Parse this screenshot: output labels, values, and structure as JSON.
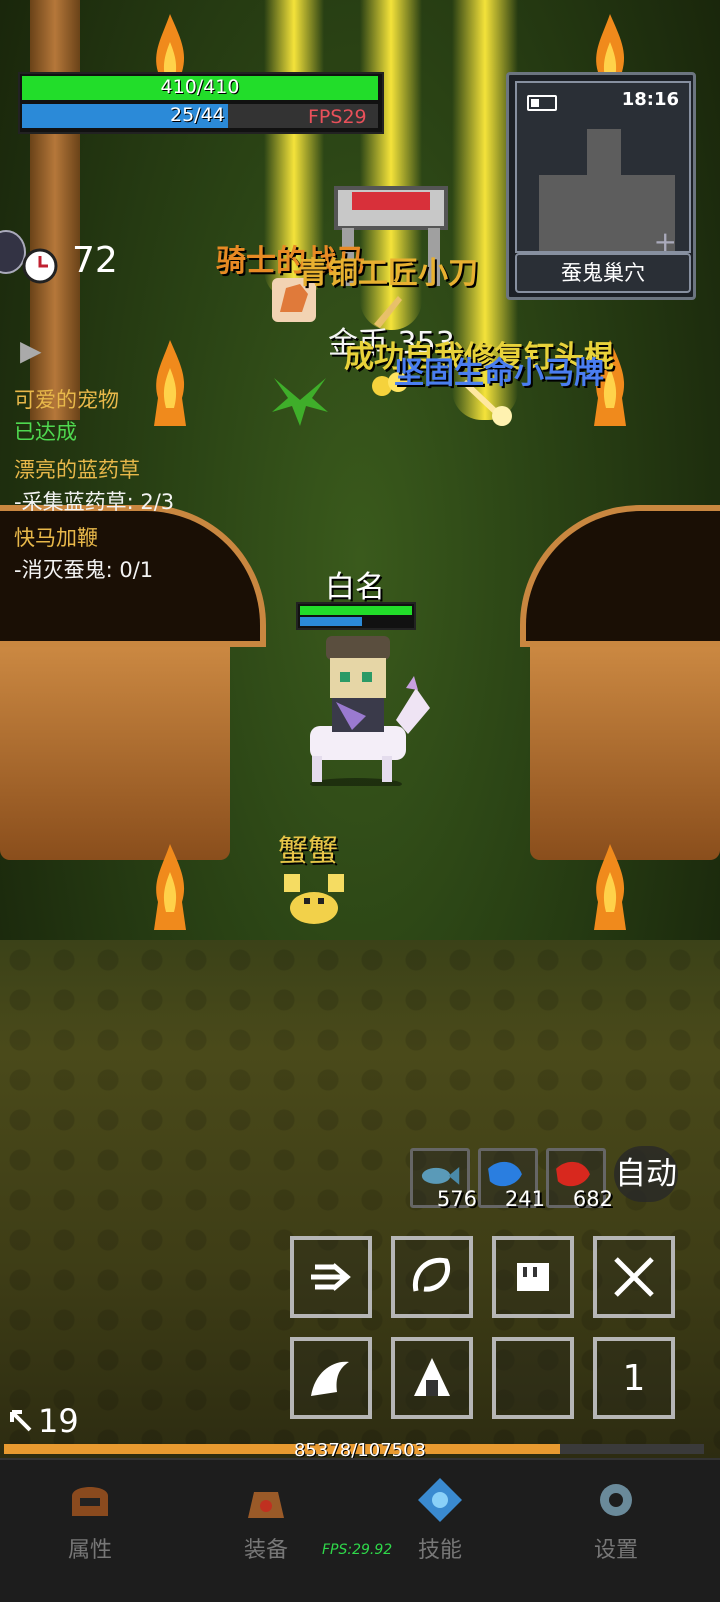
{
  "hud": {
    "hp": "410/410",
    "mp": "25/44",
    "fps_top": "FPS29",
    "timer": "72",
    "level": "19",
    "xp": "85378/107503"
  },
  "minimap": {
    "time": "18:16",
    "plus": "+",
    "location": "蚕鬼巢穴"
  },
  "quests": [
    {
      "title": "可爱的宠物",
      "status": "已达成"
    },
    {
      "title": "漂亮的蓝药草",
      "status": "-采集蓝药草: 2/3"
    },
    {
      "title": "快马加鞭",
      "status": "-消灭蚕鬼: 0/1"
    }
  ],
  "floating_text": {
    "item1": "骑士的战马",
    "item2": "青铜工匠小刀",
    "gold": "金币 353",
    "success": "成功自我修复钉头棍",
    "item3": "坚固生命小马牌"
  },
  "player": {
    "name": "白名"
  },
  "enemy": {
    "name": "蟹蟹"
  },
  "potions": [
    {
      "icon": "fish-icon",
      "count": "576"
    },
    {
      "icon": "blue-potion-icon",
      "count": "241"
    },
    {
      "icon": "red-potion-icon",
      "count": "682"
    }
  ],
  "auto_label": "自动",
  "skill_slot_number": "1",
  "nav": {
    "attributes": "属性",
    "equipment": "装备",
    "skills": "技能",
    "settings": "设置"
  },
  "fps_bottom": "FPS:29.92",
  "colors": {
    "hp_bar": "#22dd2a",
    "mp_bar": "#2b8ad8",
    "xp_bar": "#e89a30",
    "quest_title": "#e8b84a",
    "quest_done": "#4fd84f"
  }
}
